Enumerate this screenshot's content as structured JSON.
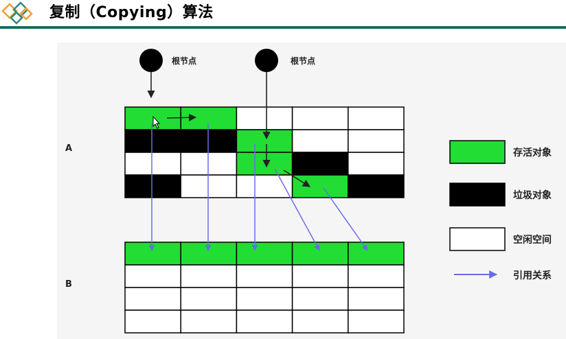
{
  "title": "复制（Copying）算法",
  "root_label_1": "根节点",
  "root_label_2": "根节点",
  "region_a_label": "A",
  "region_b_label": "B",
  "legend": {
    "live": "存活对象",
    "garbage": "垃圾对象",
    "free": "空闲空间",
    "reference": "引用关系"
  },
  "colors": {
    "live": "#22dd33",
    "garbage": "#000000",
    "free": "#ffffff",
    "reference_arrow": "#6b6bea",
    "pointer_arrow": "#222222",
    "header_rule": "#1f6b63",
    "logo_orange": "#f0a030",
    "logo_teal": "#2a8a80"
  },
  "region_a": [
    [
      "live",
      "live",
      "free",
      "free",
      "free"
    ],
    [
      "garbage",
      "garbage",
      "live",
      "free",
      "free"
    ],
    [
      "free",
      "free",
      "live",
      "garbage",
      "free"
    ],
    [
      "garbage",
      "free",
      "free",
      "live",
      "garbage"
    ]
  ],
  "region_b": [
    [
      "live",
      "live",
      "live",
      "live",
      "live"
    ],
    [
      "free",
      "free",
      "free",
      "free",
      "free"
    ],
    [
      "free",
      "free",
      "free",
      "free",
      "free"
    ],
    [
      "free",
      "free",
      "free",
      "free",
      "free"
    ]
  ]
}
